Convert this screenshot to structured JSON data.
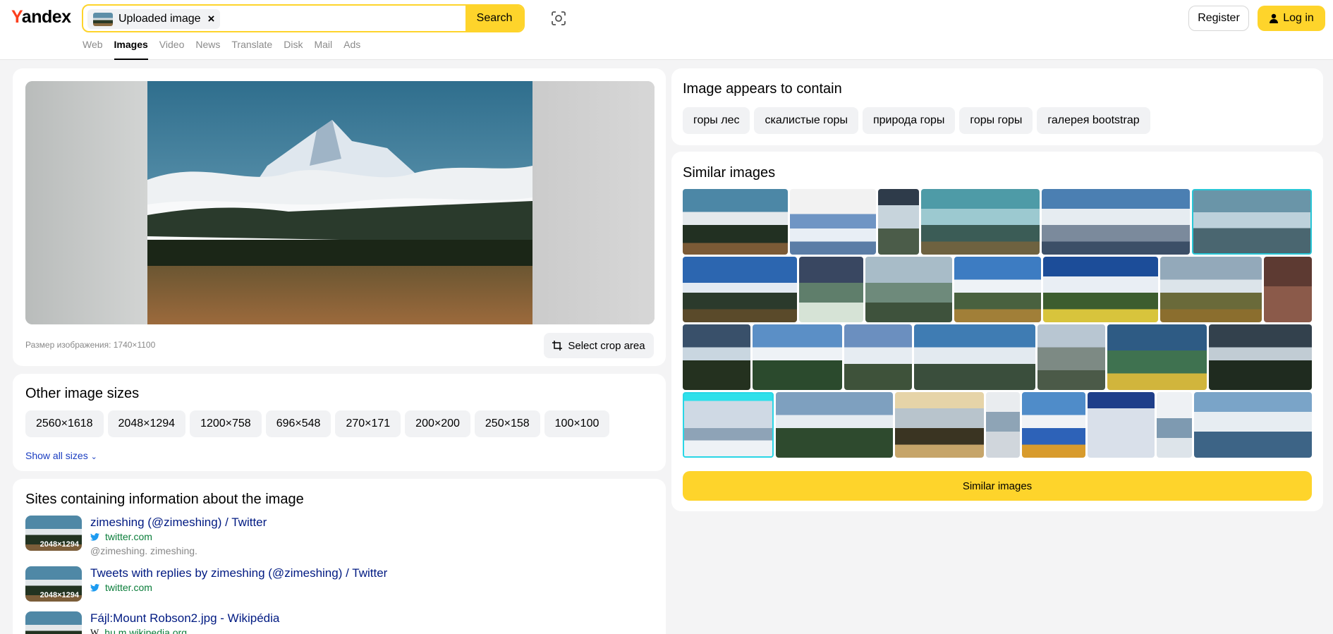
{
  "header": {
    "logo_y": "Y",
    "logo_rest": "andex",
    "search_chip_label": "Uploaded image",
    "search_clear": "×",
    "search_button": "Search",
    "register": "Register",
    "login": "Log in",
    "tabs": [
      "Web",
      "Images",
      "Video",
      "News",
      "Translate",
      "Disk",
      "Mail",
      "Ads"
    ],
    "active_tab": "Images"
  },
  "preview": {
    "size_note": "Размер изображения: 1740×1100",
    "crop_button": "Select crop area"
  },
  "sizes": {
    "title": "Other image sizes",
    "items": [
      "2560×1618",
      "2048×1294",
      "1200×758",
      "696×548",
      "270×171",
      "200×200",
      "250×158",
      "100×100"
    ],
    "show_all": "Show all sizes"
  },
  "sites": {
    "title": "Sites containing information about the image",
    "items": [
      {
        "thumb_size": "2048×1294",
        "title": "zimeshing (@zimeshing) / Twitter",
        "host": "twitter.com",
        "desc": "@zimeshing. zimeshing."
      },
      {
        "thumb_size": "2048×1294",
        "title": "Tweets with replies by zimeshing (@zimeshing) / Twitter",
        "host": "twitter.com",
        "desc": ""
      },
      {
        "thumb_size": "",
        "title": "Fájl:Mount Robson2.jpg - Wikipédia",
        "host": "hu.m.wikipedia.org",
        "desc": ""
      }
    ]
  },
  "contains": {
    "title": "Image appears to contain",
    "tags": [
      "горы лес",
      "скалистые горы",
      "природа горы",
      "горы горы",
      "галерея bootstrap"
    ]
  },
  "similar": {
    "title": "Similar images",
    "button": "Similar images"
  },
  "colors": {
    "accent": "#fed42b",
    "logo_red": "#fc3f1d",
    "link": "#001a82",
    "host_green": "#0a7d3a"
  }
}
